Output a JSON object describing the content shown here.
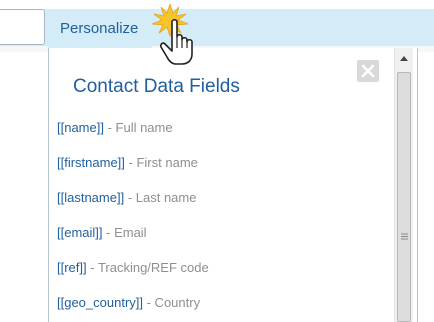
{
  "header": {
    "personalize_label": "Personalize"
  },
  "panel": {
    "title": "Contact Data Fields",
    "fields": [
      {
        "token": "[[name]]",
        "desc": " - Full name"
      },
      {
        "token": "[[firstname]]",
        "desc": " - First name"
      },
      {
        "token": "[[lastname]]",
        "desc": " - Last name"
      },
      {
        "token": "[[email]]",
        "desc": " - Email"
      },
      {
        "token": "[[ref]]",
        "desc": " - Tracking/REF code"
      },
      {
        "token": "[[geo_country]]",
        "desc": " - Country"
      }
    ]
  },
  "icons": {
    "cursor": "hand-pointer-icon",
    "close": "close-icon",
    "scroll_up": "scroll-up-arrow-icon",
    "grip": "scroll-grip-icon"
  },
  "colors": {
    "accent": "#1f5f9e",
    "bar": "#d3ecf7",
    "muted": "#8f8f8f"
  }
}
